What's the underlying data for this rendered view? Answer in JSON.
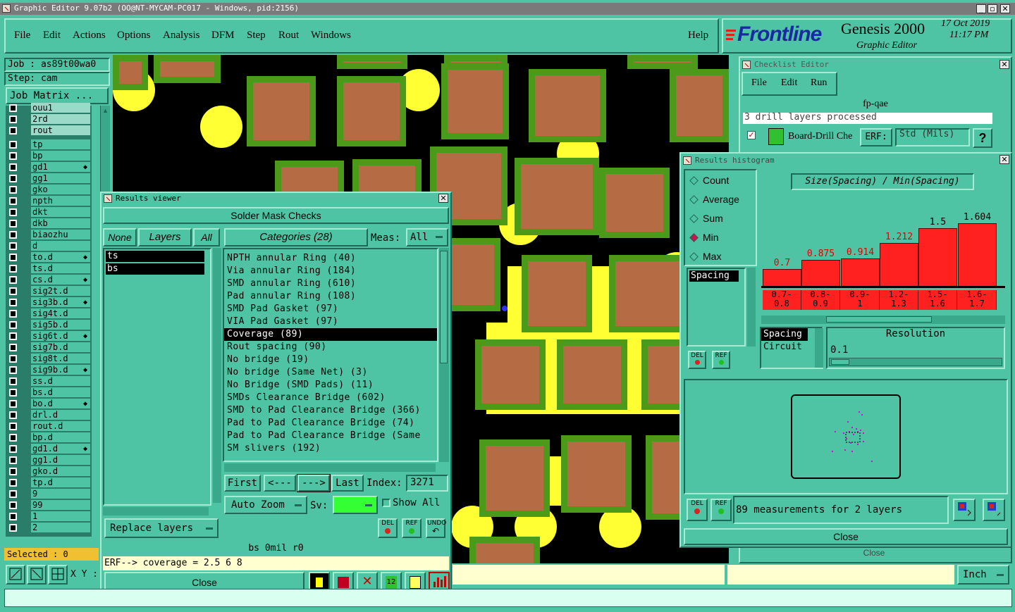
{
  "main_window": {
    "title": "Graphic Editor 9.07b2 (OO@NT-MYCAM-PC017 - Windows, pid:2156)",
    "menu": [
      "File",
      "Edit",
      "Actions",
      "Options",
      "Analysis",
      "DFM",
      "Step",
      "Rout",
      "Windows"
    ],
    "help": "Help"
  },
  "brand": {
    "logo": "Frontline",
    "product": "Genesis 2000",
    "subtitle": "Graphic Editor",
    "date": "17 Oct 2019",
    "time": "11:17 PM"
  },
  "job_panel": {
    "job": "Job : as89t00wa0",
    "step": "Step: cam",
    "job_matrix_button": "Job Matrix ...",
    "layers": [
      {
        "name": "ouu1",
        "flag": ""
      },
      {
        "name": "2rd",
        "flag": ""
      },
      {
        "name": "rout",
        "flag": ""
      },
      {
        "name": "tp",
        "flag": ""
      },
      {
        "name": "bp",
        "flag": ""
      },
      {
        "name": "gd1",
        "flag": "◆"
      },
      {
        "name": "gg1",
        "flag": ""
      },
      {
        "name": "gko",
        "flag": ""
      },
      {
        "name": "npth",
        "flag": ""
      },
      {
        "name": "dkt",
        "flag": ""
      },
      {
        "name": "dkb",
        "flag": ""
      },
      {
        "name": "biaozhu",
        "flag": ""
      },
      {
        "name": "d",
        "flag": ""
      },
      {
        "name": "to.d",
        "flag": "◆"
      },
      {
        "name": "ts.d",
        "flag": ""
      },
      {
        "name": "cs.d",
        "flag": "◆"
      },
      {
        "name": "sig2t.d",
        "flag": ""
      },
      {
        "name": "sig3b.d",
        "flag": "◆"
      },
      {
        "name": "sig4t.d",
        "flag": ""
      },
      {
        "name": "sig5b.d",
        "flag": ""
      },
      {
        "name": "sig6t.d",
        "flag": "◆"
      },
      {
        "name": "sig7b.d",
        "flag": ""
      },
      {
        "name": "sig8t.d",
        "flag": ""
      },
      {
        "name": "sig9b.d",
        "flag": "◆"
      },
      {
        "name": "ss.d",
        "flag": ""
      },
      {
        "name": "bs.d",
        "flag": ""
      },
      {
        "name": "bo.d",
        "flag": "◆"
      },
      {
        "name": "drl.d",
        "flag": ""
      },
      {
        "name": "rout.d",
        "flag": ""
      },
      {
        "name": "bp.d",
        "flag": ""
      },
      {
        "name": "gd1.d",
        "flag": "◆"
      },
      {
        "name": "gg1.d",
        "flag": ""
      },
      {
        "name": "gko.d",
        "flag": ""
      },
      {
        "name": "tp.d",
        "flag": ""
      },
      {
        "name": "9",
        "flag": ""
      },
      {
        "name": "99",
        "flag": ""
      },
      {
        "name": "1",
        "flag": ""
      },
      {
        "name": "2",
        "flag": ""
      }
    ],
    "selected": "Selected : 0",
    "xy_label": "X Y :"
  },
  "results_viewer": {
    "title": "Results viewer",
    "header": "Solder Mask Checks",
    "none_btn": "None",
    "layers_btn": "Layers",
    "all_btn": "All",
    "layer_list": [
      "ts",
      "bs"
    ],
    "categories_btn": "Categories (28)",
    "meas_label": "Meas:",
    "meas_value": "All",
    "categories": [
      "NPTH annular Ring (40)",
      "Via annular Ring (184)",
      "SMD annular Ring (610)",
      "Pad annular Ring (108)",
      "SMD Pad Gasket (97)",
      "VIA Pad Gasket (97)",
      "Coverage (89)",
      "Rout spacing (90)",
      "No bridge (19)",
      "No bridge (Same Net) (3)",
      "No Bridge (SMD Pads) (11)",
      "SMDs Clearance Bridge (602)",
      "SMD to Pad Clearance Bridge (366)",
      "Pad to Pad Clearance Bridge (74)",
      "Pad to Pad Clearance Bridge (Same",
      "SM slivers (192)"
    ],
    "selected_category": 6,
    "first": "First",
    "prev": "<---",
    "next": "--->",
    "last": "Last",
    "index_label": "Index:",
    "index_value": "3271",
    "auto_zoom": "Auto Zoom",
    "sv_label": "Sv:",
    "show_all": "Show All",
    "replace_layers": "Replace layers",
    "del": "DEL",
    "ref": "REF",
    "undo": "UNDO",
    "status_line": "bs 0mil r0",
    "erf_line": "ERF--> coverage = 2.5 6 8",
    "close": "Close"
  },
  "checklist_editor": {
    "title": "Checklist Editor",
    "menu": [
      "File",
      "Edit",
      "Run"
    ],
    "name": "fp-qae",
    "status": "3 drill layers processed",
    "row_label": "Board-Drill Che",
    "erf_label": "ERF:",
    "erf_value": "Std (Mils)",
    "help": "?",
    "close": "Close"
  },
  "histogram": {
    "title": "Results histogram",
    "modes": [
      "Count",
      "Average",
      "Sum",
      "Min",
      "Max"
    ],
    "selected_mode": "Min",
    "chart_title": "Size(Spacing) / Min(Spacing)",
    "list_items": [
      "Spacing"
    ],
    "attr_items": [
      "Spacing",
      "Circuit"
    ],
    "resolution_label": "Resolution",
    "resolution_value": "0.1",
    "summary": "89 measurements for 2 layers",
    "close": "Close",
    "del": "DEL",
    "ref": "REF"
  },
  "chart_data": {
    "type": "bar",
    "title": "Size(Spacing) / Min(Spacing)",
    "categories": [
      "0.7-0.8",
      "0.8-0.9",
      "0.9-1",
      "1.2-1.3",
      "1.5-1.6",
      "1.6-1.7"
    ],
    "values": [
      0.7,
      0.875,
      0.914,
      1.212,
      1.5,
      1.604
    ],
    "value_labels": [
      "0.7",
      "0.875",
      "0.914",
      "1.212",
      "1.5",
      "1.604"
    ],
    "bin_top": [
      "0.7-",
      "0.8-",
      "0.9-",
      "1.2-",
      "1.5-",
      "1.6-"
    ],
    "bin_bottom": [
      "0.8",
      "0.9",
      "1",
      "1.3",
      "1.6",
      "1.7"
    ],
    "ylim": [
      0,
      1.7
    ],
    "colors": {
      "bar": "#ff2020",
      "label": "#e00000"
    }
  },
  "units": {
    "value": "Inch"
  },
  "colors": {
    "background": "#4fc4a4",
    "pad": "#b56c45",
    "mask": "#4c9a1a",
    "highlight": "#ffff33",
    "titlebar": "#7a7a7a"
  }
}
